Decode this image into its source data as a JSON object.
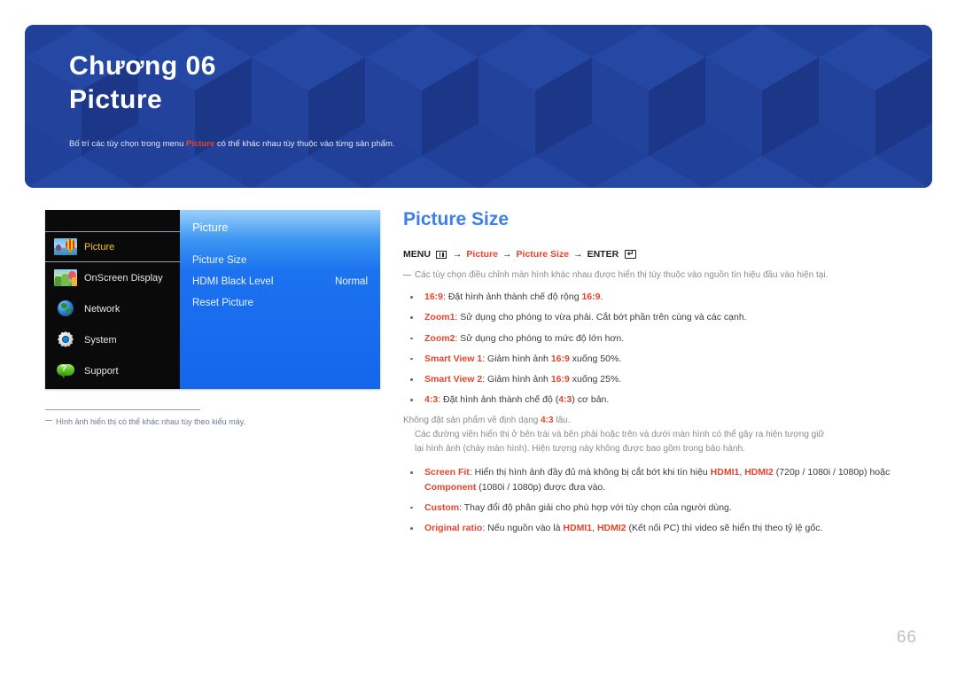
{
  "banner": {
    "chapter": "Chương 06",
    "title": "Picture",
    "note_before": "Bố trí các tùy chọn trong menu ",
    "note_accent": "Picture",
    "note_after": " có thể khác nhau tùy thuộc vào từng sản phẩm.",
    "bg_color": "#22409a"
  },
  "osd": {
    "items": [
      {
        "label": "Picture",
        "icon": "balloon-photo-icon",
        "selected": true
      },
      {
        "label": "OnScreen Display",
        "icon": "landscape-photo-icon",
        "selected": false
      },
      {
        "label": "Network",
        "icon": "globe-icon",
        "selected": false
      },
      {
        "label": "System",
        "icon": "gear-icon",
        "selected": false
      },
      {
        "label": "Support",
        "icon": "question-bubble-icon",
        "selected": false
      }
    ],
    "panel_title": "Picture",
    "rows": [
      {
        "label": "Picture Size",
        "value": ""
      },
      {
        "label": "HDMI Black Level",
        "value": "Normal"
      },
      {
        "label": "Reset Picture",
        "value": ""
      }
    ],
    "selected_label_color": "#f0c419",
    "panel_color": "#1466ec",
    "footnote": "Hình ảnh hiển thị có thể khác nhau tùy theo kiểu máy."
  },
  "content": {
    "section_title": "Picture Size",
    "section_title_color": "#3a80e8",
    "accent_color": "#e8442a",
    "menu_path": {
      "menu_label": "MENU",
      "menu_icon": "menu-bars-icon",
      "arrow": "→",
      "step1": "Picture",
      "step2": "Picture Size",
      "enter_label": "ENTER",
      "enter_icon": "enter-key-icon"
    },
    "intro_note": "Các tùy chọn điều chỉnh màn hình khác nhau được hiển thị tùy thuộc vào nguồn tín hiệu đầu vào hiện tại.",
    "bullets": [
      {
        "term": "16:9",
        "parts": [
          {
            "t": ": Đặt hình ảnh thành chế độ rộng ",
            "hl": false
          },
          {
            "t": "16:9",
            "hl": true
          },
          {
            "t": ".",
            "hl": false
          }
        ]
      },
      {
        "term": "Zoom1",
        "parts": [
          {
            "t": ": Sử dụng cho phóng to vừa phải. Cắt bớt phần trên cùng và các cạnh.",
            "hl": false
          }
        ]
      },
      {
        "term": "Zoom2",
        "parts": [
          {
            "t": ": Sử dụng cho phóng to mức độ lớn hơn.",
            "hl": false
          }
        ]
      },
      {
        "term": "Smart View 1",
        "parts": [
          {
            "t": ": Giảm hình ảnh ",
            "hl": false
          },
          {
            "t": "16:9",
            "hl": true
          },
          {
            "t": " xuống 50%.",
            "hl": false
          }
        ]
      },
      {
        "term": "Smart View 2",
        "parts": [
          {
            "t": ": Giảm hình ảnh ",
            "hl": false
          },
          {
            "t": "16:9",
            "hl": true
          },
          {
            "t": " xuống 25%.",
            "hl": false
          }
        ]
      },
      {
        "term": "4:3",
        "parts": [
          {
            "t": ": Đặt hình ảnh thành chế độ (",
            "hl": false
          },
          {
            "t": "4:3",
            "hl": true
          },
          {
            "t": ") cơ bản.",
            "hl": false
          }
        ]
      }
    ],
    "subnote": {
      "line1_before": "Không đặt sản phẩm về định dạng ",
      "line1_accent": "4:3",
      "line1_after": " lâu.",
      "line2": "Các đường viền hiển thị ở bên trái và bên phải hoặc trên và dưới màn hình có thể gây ra hiện tượng giữ",
      "line3": "lại hình ảnh (cháy màn hình). Hiện tượng này không được bao gồm trong bảo hành."
    },
    "bullets2": [
      {
        "term": "Screen Fit",
        "parts": [
          {
            "t": ": Hiển thị hình ảnh đầy đủ mà không bị cắt bớt khi tín hiệu ",
            "hl": false
          },
          {
            "t": "HDMI1",
            "hl": true
          },
          {
            "t": ", ",
            "hl": false
          },
          {
            "t": "HDMI2",
            "hl": true
          },
          {
            "t": " (720p / 1080i / 1080p) hoặc ",
            "hl": false
          },
          {
            "t": "Component",
            "hl": true
          },
          {
            "t": " (1080i / 1080p) được đưa vào.",
            "hl": false
          }
        ]
      },
      {
        "term": "Custom",
        "parts": [
          {
            "t": ": Thay đổi độ phân giải cho phù hợp với tùy chọn của người dùng.",
            "hl": false
          }
        ]
      },
      {
        "term": "Original ratio",
        "parts": [
          {
            "t": ": Nếu nguồn vào là ",
            "hl": false
          },
          {
            "t": "HDMI1",
            "hl": true
          },
          {
            "t": ", ",
            "hl": false
          },
          {
            "t": "HDMI2",
            "hl": true
          },
          {
            "t": " (Kết nối PC) thì video sẽ hiển thị theo tỷ lệ gốc.",
            "hl": false
          }
        ]
      }
    ]
  },
  "page_number": "66"
}
